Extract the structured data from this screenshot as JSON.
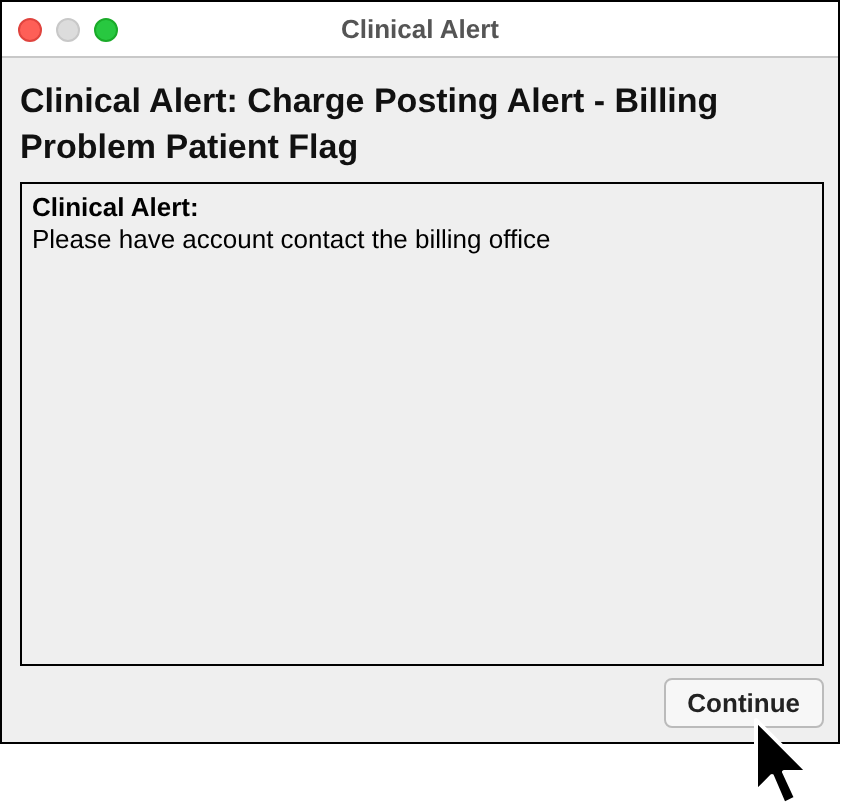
{
  "window": {
    "title": "Clinical Alert"
  },
  "heading": "Clinical Alert: Charge Posting Alert - Billing Problem Patient Flag",
  "message": {
    "label": "Clinical Alert:",
    "text": "Please have account contact the billing office"
  },
  "buttons": [
    "Continue"
  ]
}
